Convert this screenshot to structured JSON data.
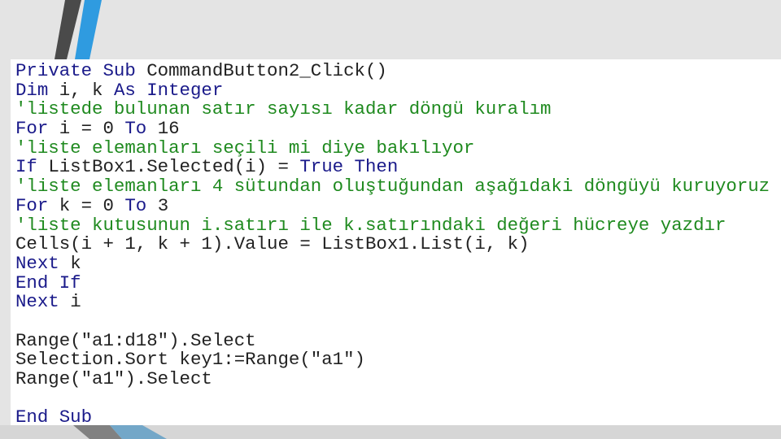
{
  "colors": {
    "keyword": "#1a1a8a",
    "comment": "#1f8a1f",
    "text": "#222222",
    "stripe_dark": "#4a4a4a",
    "stripe_blue": "#2f9be0"
  },
  "code_lines": [
    [
      {
        "t": "kw",
        "s": "Private Sub "
      },
      {
        "t": "tx",
        "s": "CommandButton2_Click()"
      }
    ],
    [
      {
        "t": "kw",
        "s": "Dim "
      },
      {
        "t": "tx",
        "s": "i, k "
      },
      {
        "t": "kw",
        "s": "As Integer"
      }
    ],
    [
      {
        "t": "cm",
        "s": "'listede bulunan satır sayısı kadar döngü kuralım"
      }
    ],
    [
      {
        "t": "kw",
        "s": "For "
      },
      {
        "t": "tx",
        "s": "i = 0 "
      },
      {
        "t": "kw",
        "s": "To "
      },
      {
        "t": "tx",
        "s": "16"
      }
    ],
    [
      {
        "t": "cm",
        "s": "'liste elemanları seçili mi diye bakılıyor"
      }
    ],
    [
      {
        "t": "kw",
        "s": "If "
      },
      {
        "t": "tx",
        "s": "ListBox1.Selected(i) = "
      },
      {
        "t": "kw",
        "s": "True Then"
      }
    ],
    [
      {
        "t": "cm",
        "s": "'liste elemanları 4 sütundan oluştuğundan aşağıdaki döngüyü kuruyoruz"
      }
    ],
    [
      {
        "t": "kw",
        "s": "For "
      },
      {
        "t": "tx",
        "s": "k = 0 "
      },
      {
        "t": "kw",
        "s": "To "
      },
      {
        "t": "tx",
        "s": "3"
      }
    ],
    [
      {
        "t": "cm",
        "s": "'liste kutusunun i.satırı ile k.satırındaki değeri hücreye yazdır"
      }
    ],
    [
      {
        "t": "tx",
        "s": "Cells(i + 1, k + 1).Value = ListBox1.List(i, k)"
      }
    ],
    [
      {
        "t": "kw",
        "s": "Next "
      },
      {
        "t": "tx",
        "s": "k"
      }
    ],
    [
      {
        "t": "kw",
        "s": "End If"
      }
    ],
    [
      {
        "t": "kw",
        "s": "Next "
      },
      {
        "t": "tx",
        "s": "i"
      }
    ],
    [],
    [
      {
        "t": "tx",
        "s": "Range(\"a1:d18\").Select"
      }
    ],
    [
      {
        "t": "tx",
        "s": "Selection.Sort key1:=Range(\"a1\")"
      }
    ],
    [
      {
        "t": "tx",
        "s": "Range(\"a1\").Select"
      }
    ],
    [],
    [
      {
        "t": "kw",
        "s": "End Sub"
      }
    ]
  ]
}
